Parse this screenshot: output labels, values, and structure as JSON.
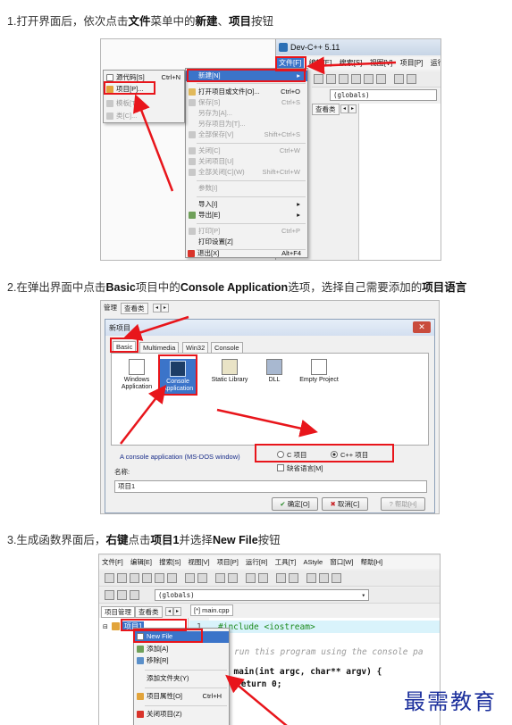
{
  "step1": {
    "text_a": "1.打开界面后，依次点击",
    "b1": "文件",
    "text_b": "菜单中的",
    "b2": "新建",
    "text_c": "、",
    "b3": "项目",
    "text_d": "按钮"
  },
  "ss1": {
    "title": "Dev-C++ 5.11",
    "menu": [
      "文件[F]",
      "编辑[E]",
      "搜索[S]",
      "视图[V]",
      "项目[P]",
      "运行"
    ],
    "globals": "(globals)",
    "class_tab": "查看类",
    "file_menu": [
      {
        "label": "新建[N]",
        "sc": "",
        "dis": false
      },
      {
        "label": "打开项目或文件[O]...",
        "sc": "Ctrl+O",
        "dis": false
      },
      {
        "label": "保存[S]",
        "sc": "Ctrl+S",
        "dis": true
      },
      {
        "label": "另存为[A]...",
        "sc": "",
        "dis": true
      },
      {
        "label": "另存项目为[T]...",
        "sc": "",
        "dis": true
      },
      {
        "label": "全部保存[V]",
        "sc": "Shift+Ctrl+S",
        "dis": true
      },
      {
        "label": "关闭[C]",
        "sc": "Ctrl+W",
        "dis": true
      },
      {
        "label": "关闭项目[U]",
        "sc": "",
        "dis": true
      },
      {
        "label": "全部关闭[C](W)",
        "sc": "Shift+Ctrl+W",
        "dis": true
      },
      {
        "label": "参数[I]",
        "sc": "",
        "dis": true
      },
      {
        "label": "导入[I]",
        "sc": "",
        "dis": false
      },
      {
        "label": "导出[E]",
        "sc": "",
        "dis": false
      },
      {
        "label": "打印[P]",
        "sc": "Ctrl+P",
        "dis": true
      },
      {
        "label": "打印设置[Z]",
        "sc": "",
        "dis": false
      },
      {
        "label": "退出[X]",
        "sc": "Alt+F4",
        "dis": false
      }
    ],
    "sub_menu": [
      {
        "label": "源代码[S]",
        "sc": "Ctrl+N"
      },
      {
        "label": "项目[P]...",
        "sc": ""
      },
      {
        "label": "模板[T]...",
        "sc": ""
      },
      {
        "label": "类[C]...",
        "sc": ""
      }
    ]
  },
  "step2": {
    "text_a": "2.在弹出界面中点击",
    "b1": "Basic",
    "text_b": "项目中的",
    "b2": "Console Application",
    "text_c": "选项，选择自己需要添加的",
    "b3": "项目语言"
  },
  "ss2": {
    "top_tabs": [
      "管理",
      "查看类"
    ],
    "dialog_title": "新项目",
    "tabs": [
      "Basic",
      "Multimedia",
      "Win32",
      "Console"
    ],
    "items": [
      "Windows Application",
      "Console Application",
      "Static Library",
      "DLL",
      "Empty Project"
    ],
    "desc": "A console application (MS-DOS window)",
    "c_option": "C 项目",
    "cpp_option": "C++ 项目",
    "default_lang": "缺省语言[M]",
    "name_label": "名称:",
    "name_value": "项目1",
    "ok": "确定[O]",
    "cancel": "取消[C]",
    "help": "帮助[H]"
  },
  "step3": {
    "text_a": "3.生成函数界面后，",
    "b1": "右键",
    "text_b": "点击",
    "b2": "项目1",
    "text_c": "并选择",
    "b3": "New File",
    "text_d": "按钮"
  },
  "ss3": {
    "menu": [
      "文件[F]",
      "编辑[E]",
      "搜索[S]",
      "视图[V]",
      "项目[P]",
      "运行[R]",
      "工具[T]",
      "AStyle",
      "窗口[W]",
      "帮助[H]"
    ],
    "globals": "(globals)",
    "tabs": [
      "项目管理",
      "查看类"
    ],
    "editor_tab": "[*] main.cpp",
    "tree_item": "项目1",
    "ctx_menu": [
      {
        "label": "New File",
        "sc": ""
      },
      {
        "label": "添加[A]",
        "sc": ""
      },
      {
        "label": "移除[R]",
        "sc": ""
      },
      {
        "label": "添加文件夹(Y)",
        "sc": ""
      },
      {
        "label": "项目属性[O]",
        "sc": "Ctrl+H"
      },
      {
        "label": "关闭项目(Z)",
        "sc": ""
      }
    ],
    "code": [
      {
        "n": "1",
        "t": "#include <iostream>"
      },
      {
        "n": "",
        "t": "run this program using the console pa"
      },
      {
        "n": "",
        "t": "t main(int argc, char** argv) {"
      },
      {
        "n": "",
        "t": "return 0;"
      }
    ]
  },
  "watermark": "最需教育",
  "colors": {
    "annotation_red": "#e8151b",
    "highlight_blue": "#3b74c9",
    "watermark": "#1b2f9c"
  }
}
